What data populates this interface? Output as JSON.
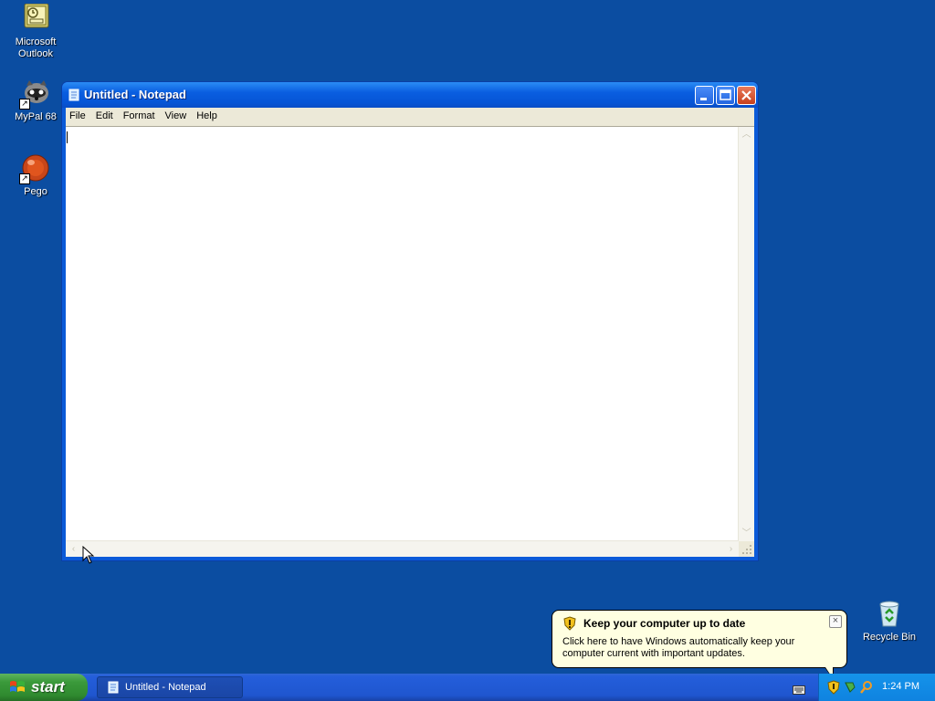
{
  "desktop": {
    "icons": [
      {
        "label": "Microsoft Outlook",
        "icon": "outlook-icon"
      },
      {
        "label": "MyPal 68",
        "icon": "raccoon-icon"
      },
      {
        "label": "Pego",
        "icon": "red-ball-icon"
      }
    ],
    "recycle_bin": {
      "label": "Recycle Bin",
      "icon": "recycle-bin-icon"
    }
  },
  "notepad": {
    "title": "Untitled - Notepad",
    "menu": [
      "File",
      "Edit",
      "Format",
      "View",
      "Help"
    ],
    "content": ""
  },
  "balloon": {
    "title": "Keep your computer up to date",
    "text": "Click here to have Windows automatically keep your computer current with important updates."
  },
  "taskbar": {
    "start_label": "start",
    "task_label": "Untitled - Notepad",
    "clock": "1:24 PM"
  },
  "colors": {
    "desktop": "#0b4da1",
    "title_bar": "#0a5ee0",
    "start_button": "#3b9a3b",
    "tray": "#1593ea",
    "balloon": "#ffffe1"
  }
}
